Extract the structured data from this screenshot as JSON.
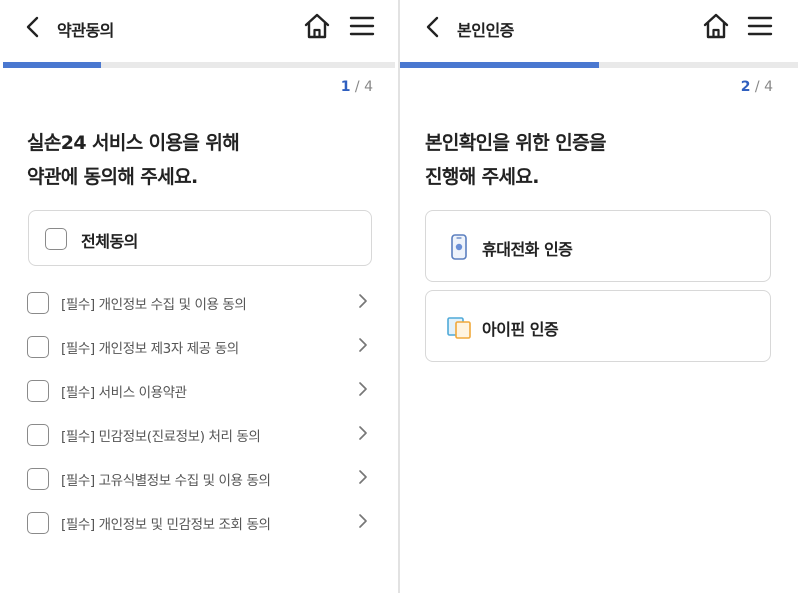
{
  "screen1": {
    "title": "약관동의",
    "step_current": "1",
    "step_total": " / 4",
    "progress": 0.25,
    "heading_line1": "실손24 서비스 이용을 위해",
    "heading_line2": "약관에 동의해 주세요.",
    "all_agree_label": "전체동의",
    "terms": [
      {
        "label": "[필수] 개인정보 수집 및 이용 동의"
      },
      {
        "label": "[필수] 개인정보 제3자 제공 동의"
      },
      {
        "label": "[필수] 서비스 이용약관"
      },
      {
        "label": "[필수] 민감정보(진료정보) 처리 동의"
      },
      {
        "label": "[필수] 고유식별정보 수집 및 이용 동의"
      },
      {
        "label": "[필수] 개인정보 및 민감정보 조회 동의"
      }
    ]
  },
  "screen2": {
    "title": "본인인증",
    "step_current": "2",
    "step_total": " / 4",
    "progress": 0.5,
    "heading_line1": "본인확인을 위한 인증을",
    "heading_line2": "진행해 주세요.",
    "options": [
      {
        "label": "휴대전화 인증",
        "icon": "mobile-phone-icon"
      },
      {
        "label": "아이핀 인증",
        "icon": "ipin-icon"
      }
    ]
  },
  "colors": {
    "accent": "#4a78d0",
    "step_current": "#2f5fbf",
    "border": "#d8d8d8",
    "progress_track": "#e9e9e9"
  }
}
